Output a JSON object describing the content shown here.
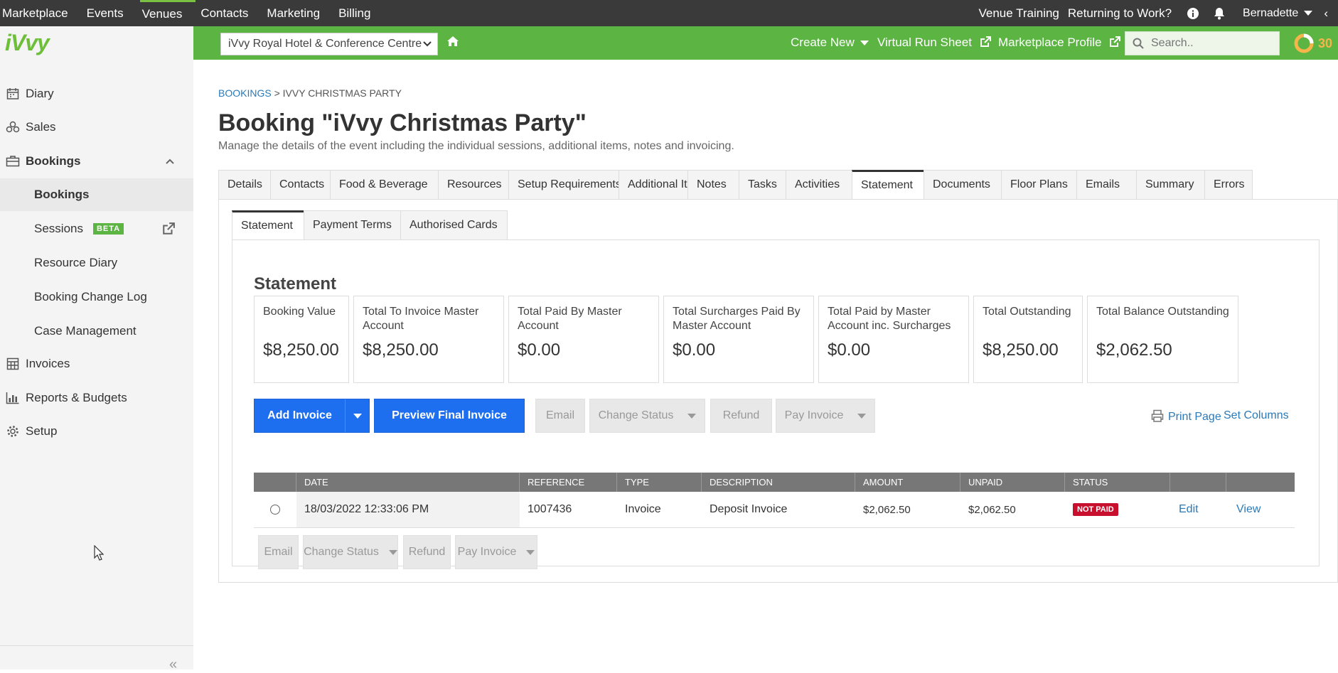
{
  "topnav": {
    "items": [
      {
        "label": "Marketplace",
        "active": false
      },
      {
        "label": "Events",
        "active": false
      },
      {
        "label": "Venues",
        "active": true
      },
      {
        "label": "Contacts",
        "active": false
      },
      {
        "label": "Marketing",
        "active": false
      },
      {
        "label": "Billing",
        "active": false
      }
    ],
    "venue_training": "Venue Training",
    "returning_to_work": "Returning to Work?",
    "user_name": "Bernadette"
  },
  "greenbar": {
    "venue_selected": "iVvy Royal Hotel & Conference Centre",
    "create_new": "Create New",
    "virtual_run_sheet": "Virtual Run Sheet",
    "marketplace_profile": "Marketplace Profile",
    "search_placeholder": "Search..",
    "counter": "30"
  },
  "sidebar": {
    "logo": "iVvy",
    "items": [
      {
        "label": "Diary",
        "icon": "calendar-icon"
      },
      {
        "label": "Sales",
        "icon": "funnel-icon"
      },
      {
        "label": "Bookings",
        "icon": "briefcase-icon"
      }
    ],
    "bookings_sub": [
      {
        "label": "Bookings"
      },
      {
        "label": "Sessions",
        "badge": "BETA"
      },
      {
        "label": "Resource Diary"
      },
      {
        "label": "Booking Change Log"
      },
      {
        "label": "Case Management"
      }
    ],
    "items_after": [
      {
        "label": "Invoices",
        "icon": "calculator-icon"
      },
      {
        "label": "Reports & Budgets",
        "icon": "bar-chart-icon"
      },
      {
        "label": "Setup",
        "icon": "gear-icon"
      }
    ]
  },
  "breadcrumb": {
    "root": "BOOKINGS",
    "sep": ">",
    "current": "IVVY CHRISTMAS PARTY"
  },
  "page": {
    "title": "Booking \"iVvy Christmas Party\"",
    "subtitle": "Manage the details of the event including the individual sessions, additional items, notes and invoicing."
  },
  "tabs": [
    "Details",
    "Contacts",
    "Food & Beverage",
    "Resources",
    "Setup Requirements",
    "Additional Items",
    "Notes",
    "Tasks",
    "Activities",
    "Statement",
    "Documents",
    "Floor Plans",
    "Emails",
    "Summary",
    "Errors"
  ],
  "subtabs": [
    "Statement",
    "Payment Terms",
    "Authorised Cards"
  ],
  "statement": {
    "heading": "Statement",
    "cards": [
      {
        "label": "Booking Value",
        "value": "$8,250.00"
      },
      {
        "label": "Total To Invoice Master Account",
        "value": "$8,250.00"
      },
      {
        "label": "Total Paid By Master Account",
        "value": "$0.00"
      },
      {
        "label": "Total Surcharges Paid By Master Account",
        "value": "$0.00"
      },
      {
        "label": "Total Paid by Master Account inc. Surcharges",
        "value": "$0.00"
      },
      {
        "label": "Total Outstanding",
        "value": "$8,250.00"
      },
      {
        "label": "Total Balance Outstanding",
        "value": "$2,062.50"
      }
    ]
  },
  "actions": {
    "add_invoice": "Add Invoice",
    "preview_final_invoice": "Preview Final Invoice",
    "email": "Email",
    "change_status": "Change Status",
    "refund": "Refund",
    "pay_invoice": "Pay Invoice",
    "print_page": "Print Page",
    "set_columns": "Set Columns"
  },
  "table": {
    "headers": [
      "DATE",
      "REFERENCE",
      "TYPE",
      "DESCRIPTION",
      "AMOUNT",
      "UNPAID",
      "STATUS"
    ],
    "rows": [
      {
        "date": "18/03/2022 12:33:06 PM",
        "reference": "1007436",
        "type": "Invoice",
        "description": "Deposit Invoice",
        "amount": "$2,062.50",
        "unpaid": "$2,062.50",
        "status": "NOT PAID",
        "edit": "Edit",
        "view": "View"
      }
    ]
  },
  "colors": {
    "accent_green": "#5cb543",
    "primary_blue": "#1e6ff0",
    "status_red": "#c8102e",
    "topbar": "#3a3a3a"
  }
}
